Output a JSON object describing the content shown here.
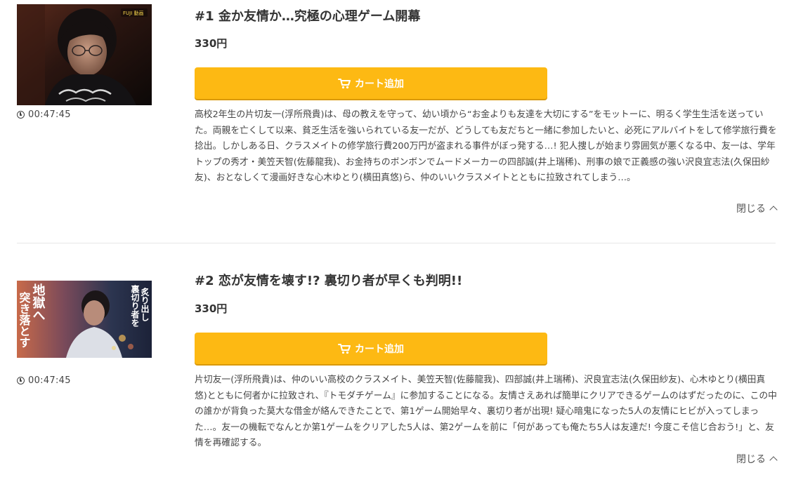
{
  "episodes": [
    {
      "title": "#1 金か友情か…究極の心理ゲーム開幕",
      "price": "330円",
      "cart_label": "カート追加",
      "duration": "00:47:45",
      "synopsis": "高校2年生の片切友一(浮所飛貴)は、母の教えを守って、幼い頃から“お金よりも友達を大切にする”をモットーに、明るく学生生活を送っていた。両親を亡くして以来、貧乏生活を強いられている友一だが、どうしても友だちと一緒に参加したいと、必死にアルバイトをして修学旅行費を捻出。しかしある日、クラスメイトの修学旅行費200万円が盗まれる事件がぼっ発する…! 犯人捜しが始まり雰囲気が悪くなる中、友一は、学年トップの秀才・美笠天智(佐藤龍我)、お金持ちのボンボンでムードメーカーの四部誠(井上瑞稀)、刑事の娘で正義感の強い沢良宜志法(久保田紗友)、おとなしくて漫画好きな心木ゆとり(横田真悠)ら、仲のいいクラスメイトとともに拉致されてしまう…。",
      "toggle_label": "閉じる"
    },
    {
      "title": "#2 恋が友情を壊す!? 裏切り者が早くも判明!!",
      "price": "330円",
      "cart_label": "カート追加",
      "duration": "00:47:45",
      "synopsis": "片切友一(浮所飛貴)は、仲のいい高校のクラスメイト、美笠天智(佐藤龍我)、四部誠(井上瑞稀)、沢良宜志法(久保田紗友)、心木ゆとり(横田真悠)とともに何者かに拉致され、『トモダチゲーム』に参加することになる。友情さえあれば簡単にクリアできるゲームのはずだったのに、この中の誰かが背負った莫大な借金が絡んできたことで、第1ゲーム開始早々、裏切り者が出現! 疑心暗鬼になった5人の友情にヒビが入ってしまった…。友一の機転でなんとか第1ゲームをクリアした5人は、第2ゲームを前に「何があっても俺たち5人は友達だ! 今度こそ信じ合おう!」と、友情を再確認する。",
      "toggle_label": "閉じる",
      "thumbnail_overlay": [
        "地獄へ",
        "突き落とす",
        "裏切り者を",
        "炙り出し"
      ]
    }
  ],
  "thumbnail_logo_text": "FUJI 動画"
}
